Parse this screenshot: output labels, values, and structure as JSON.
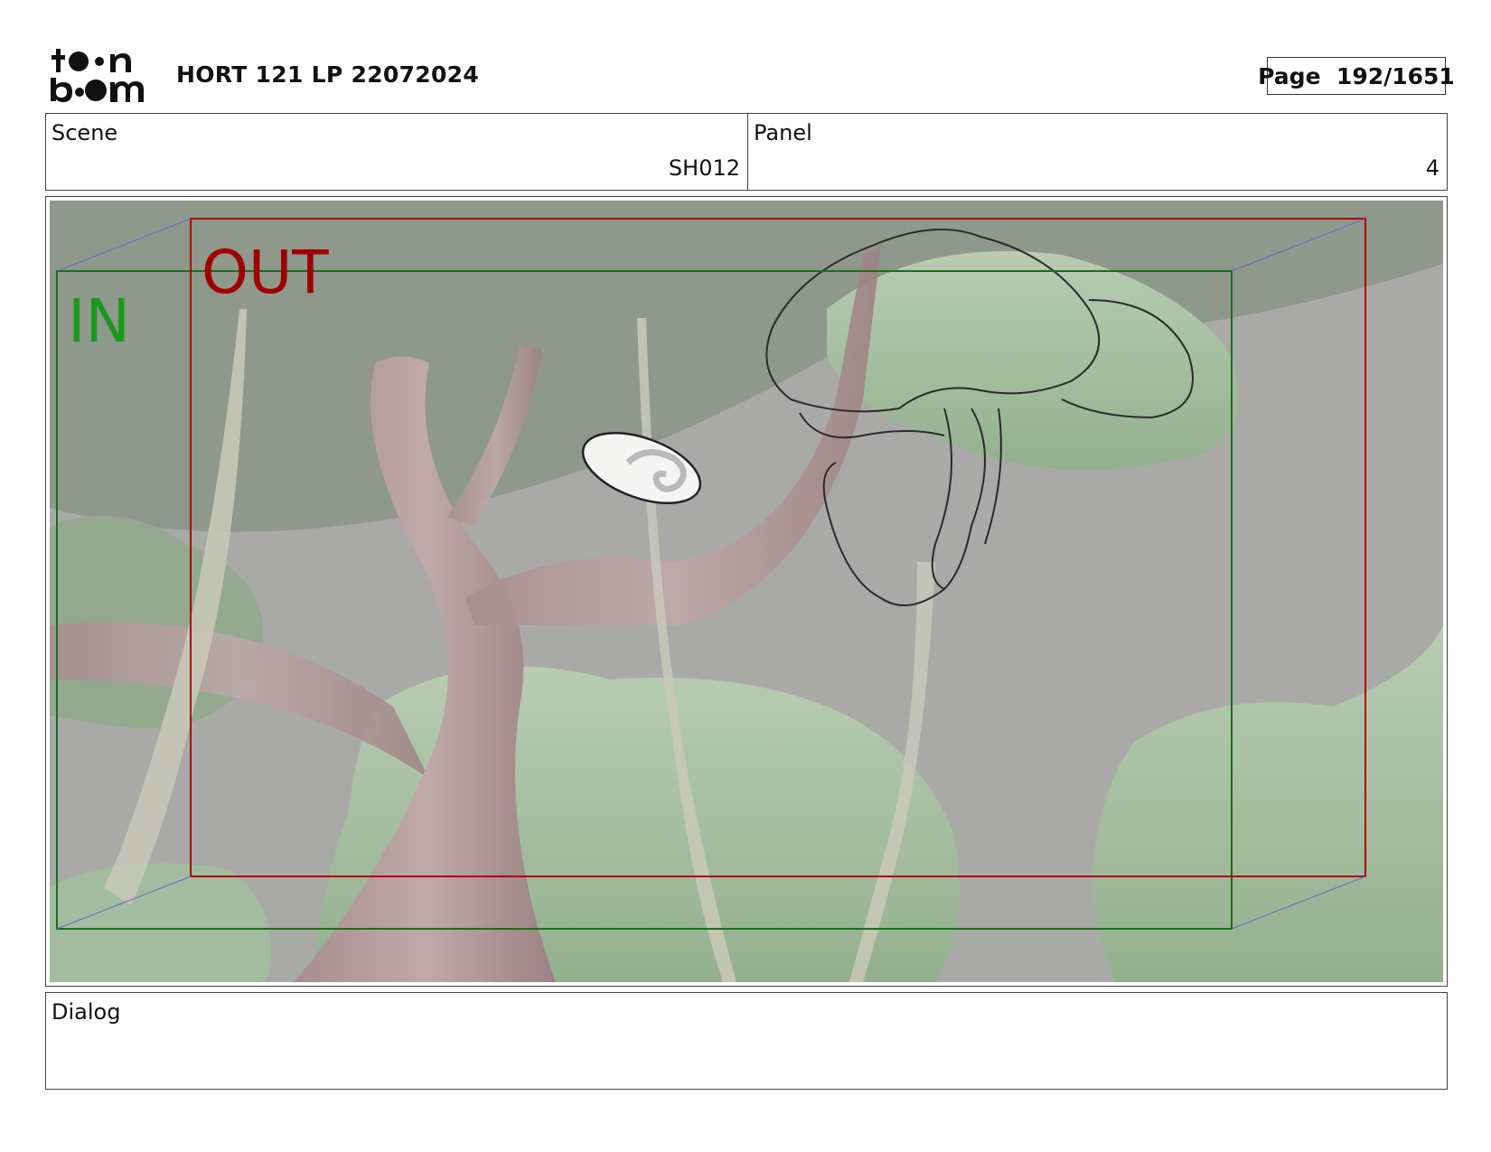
{
  "header": {
    "logo_text": "toon boom",
    "project_title": "HORT 121 LP 22072024",
    "page_label": "Page  192/1651"
  },
  "scene": {
    "label": "Scene",
    "value": "SH012"
  },
  "panel": {
    "label": "Panel",
    "value": "4"
  },
  "frame": {
    "in_label": "IN",
    "out_label": "OUT",
    "in_color": "#1a9a1a",
    "out_color": "#a00000"
  },
  "dialog": {
    "label": "Dialog",
    "text": ""
  }
}
